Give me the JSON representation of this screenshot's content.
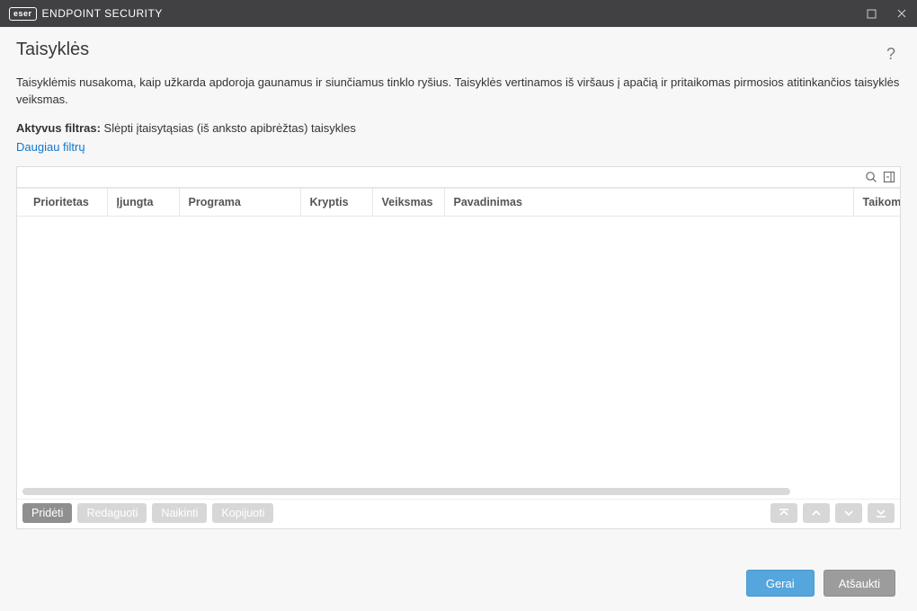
{
  "titlebar": {
    "brand_badge": "eser",
    "product_name": "ENDPOINT SECURITY"
  },
  "page": {
    "title": "Taisyklės",
    "description": "Taisyklėmis nusakoma, kaip užkarda apdoroja gaunamus ir siunčiamus tinklo ryšius. Taisyklės vertinamos iš viršaus į apačią ir pritaikomas pirmosios atitinkančios taisyklės veiksmas.",
    "filter_label": "Aktyvus filtras:",
    "filter_value": "Slėpti įtaisytąsias (iš anksto apibrėžtas) taisykles",
    "more_filters": "Daugiau filtrų"
  },
  "table": {
    "columns": {
      "priority": "Prioritetas",
      "enabled": "Įjungta",
      "program": "Programa",
      "direction": "Kryptis",
      "action": "Veiksmas",
      "name": "Pavadinimas",
      "applies": "Taikoma"
    }
  },
  "panel_buttons": {
    "add": "Pridėti",
    "edit": "Redaguoti",
    "delete": "Naikinti",
    "copy": "Kopijuoti"
  },
  "dialog_buttons": {
    "ok": "Gerai",
    "cancel": "Atšaukti"
  }
}
